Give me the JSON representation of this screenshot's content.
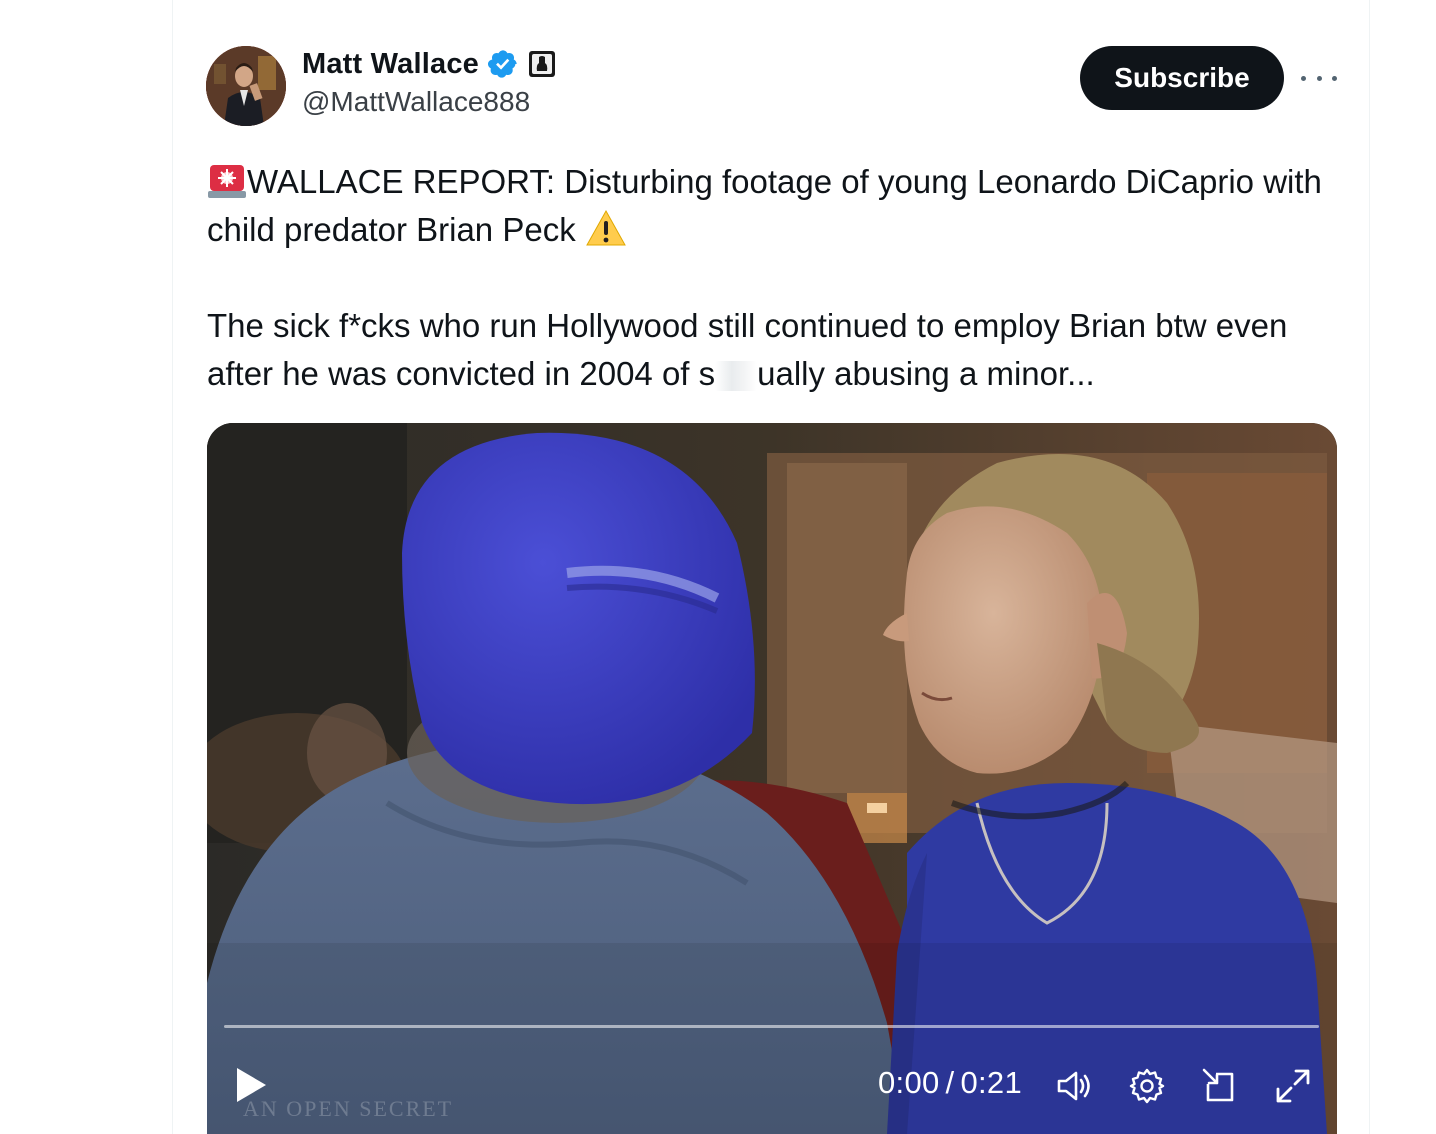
{
  "author": {
    "display_name": "Matt Wallace",
    "handle": "@MattWallace888",
    "verified": true,
    "avatar_alt": "avatar"
  },
  "actions": {
    "subscribe_label": "Subscribe",
    "more_icon": "more-horizontal-icon"
  },
  "tweet": {
    "paragraph1": {
      "emoji_lead": "🚨",
      "text": "WALLACE REPORT: Disturbing footage of young Leonardo DiCaprio with child predator Brian Peck",
      "emoji_trail": "⚠️"
    },
    "paragraph2": {
      "line_a": "The sick f*cks who run Hollywood still continued to employ Brian btw even after he was convicted in 2004 of s",
      "line_b": "ually abusing a minor..."
    }
  },
  "video": {
    "current_time": "0:00",
    "separator": "/",
    "duration": "0:21",
    "progress": 0,
    "watermark": "AN OPEN SECRET",
    "icons": [
      "play-icon",
      "volume-icon",
      "settings-gear-icon",
      "popout-icon",
      "fullscreen-icon"
    ]
  },
  "colors": {
    "subscribe_bg": "#0f1419",
    "verified_blue": "#1d9bf0",
    "text_primary": "#0f1419",
    "text_secondary": "#536471"
  }
}
